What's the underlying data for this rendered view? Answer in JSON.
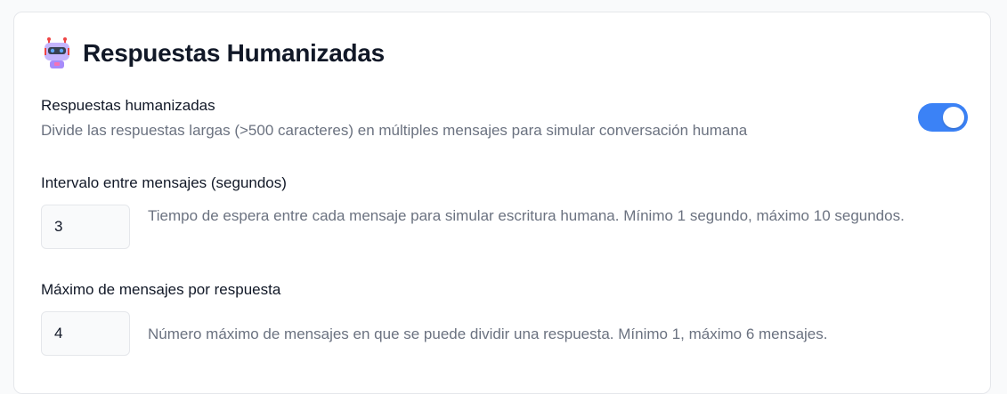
{
  "header": {
    "title": "Respuestas Humanizadas",
    "icon": "robot-icon"
  },
  "humanized": {
    "label": "Respuestas humanizadas",
    "description": "Divide las respuestas largas (>500 caracteres) en múltiples mensajes para simular conversación humana",
    "enabled": true,
    "toggle_color": "#3b82f6"
  },
  "interval": {
    "label": "Intervalo entre mensajes (segundos)",
    "value": "3",
    "help": "Tiempo de espera entre cada mensaje para simular escritura humana. Mínimo 1 segundo, máximo 10 segundos."
  },
  "max_messages": {
    "label": "Máximo de mensajes por respuesta",
    "value": "4",
    "help": "Número máximo de mensajes en que se puede dividir una respuesta. Mínimo 1, máximo 6 mensajes."
  }
}
